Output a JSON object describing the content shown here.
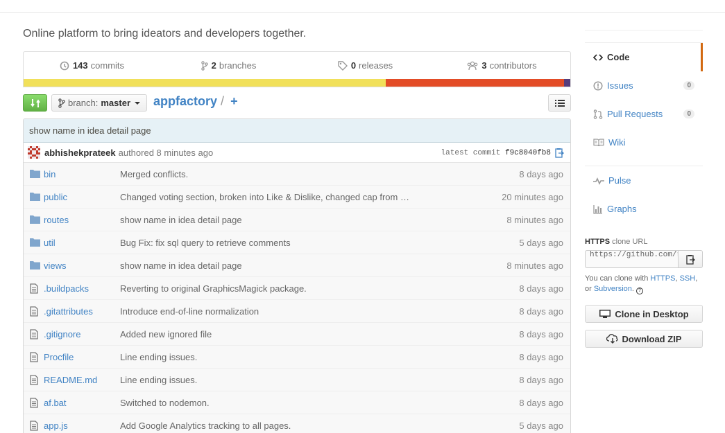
{
  "repo": {
    "description": "Online platform to bring ideators and developers together.",
    "name": "appfactory",
    "separator": "/",
    "plus": "+"
  },
  "numbers": {
    "commits": {
      "count": "143",
      "label": "commits"
    },
    "branches": {
      "count": "2",
      "label": "branches"
    },
    "releases": {
      "count": "0",
      "label": "releases"
    },
    "contributors": {
      "count": "3",
      "label": "contributors"
    }
  },
  "languages": [
    {
      "color": "#f1e05a",
      "share": 66.2
    },
    {
      "color": "#e34c26",
      "share": 32.7
    },
    {
      "color": "#563d7c",
      "share": 1.1
    }
  ],
  "branch": {
    "label": "branch:",
    "value": "master"
  },
  "latest_commit": {
    "message": "show name in idea detail page",
    "author": "abhishekprateek",
    "authored": "authored 8 minutes ago",
    "sha_label": "latest commit",
    "sha": "f9c8040fb8"
  },
  "files": [
    {
      "type": "dir",
      "name": "bin",
      "message": "Merged conflicts.",
      "age": "8 days ago"
    },
    {
      "type": "dir",
      "name": "public",
      "message": "Changed voting section, broken into Like & Dislike, changed cap from …",
      "age": "20 minutes ago"
    },
    {
      "type": "dir",
      "name": "routes",
      "message": "show name in idea detail page",
      "age": "8 minutes ago"
    },
    {
      "type": "dir",
      "name": "util",
      "message": "Bug Fix: fix sql query to retrieve comments",
      "age": "5 days ago"
    },
    {
      "type": "dir",
      "name": "views",
      "message": "show name in idea detail page",
      "age": "8 minutes ago"
    },
    {
      "type": "file",
      "name": ".buildpacks",
      "message": "Reverting to original GraphicsMagick package.",
      "age": "8 days ago"
    },
    {
      "type": "file",
      "name": ".gitattributes",
      "message": "Introduce end-of-line normalization",
      "age": "8 days ago"
    },
    {
      "type": "file",
      "name": ".gitignore",
      "message": "Added new ignored file",
      "age": "8 days ago"
    },
    {
      "type": "file",
      "name": "Procfile",
      "message": "Line ending issues.",
      "age": "8 days ago"
    },
    {
      "type": "file",
      "name": "README.md",
      "message": "Line ending issues.",
      "age": "8 days ago"
    },
    {
      "type": "file",
      "name": "af.bat",
      "message": "Switched to nodemon.",
      "age": "8 days ago"
    },
    {
      "type": "file",
      "name": "app.js",
      "message": "Add Google Analytics tracking to all pages.",
      "age": "5 days ago"
    }
  ],
  "sidebar": {
    "code": "Code",
    "issues": {
      "label": "Issues",
      "count": "0"
    },
    "pulls": {
      "label": "Pull Requests",
      "count": "0"
    },
    "wiki": "Wiki",
    "pulse": "Pulse",
    "graphs": "Graphs"
  },
  "clone": {
    "protocol": "HTTPS",
    "label_suffix": "clone URL",
    "url": "https://github.com/r",
    "help_prefix": "You can clone with",
    "https": "HTTPS",
    "comma": ",",
    "ssh": "SSH",
    "or": ", or",
    "subversion": "Subversion",
    "period": ".",
    "desktop_button": "Clone in Desktop",
    "zip_button": "Download ZIP"
  },
  "colors": {
    "link": "#4183c4",
    "selected_tab_border": "#d26911",
    "compare_button": "#60b044"
  }
}
